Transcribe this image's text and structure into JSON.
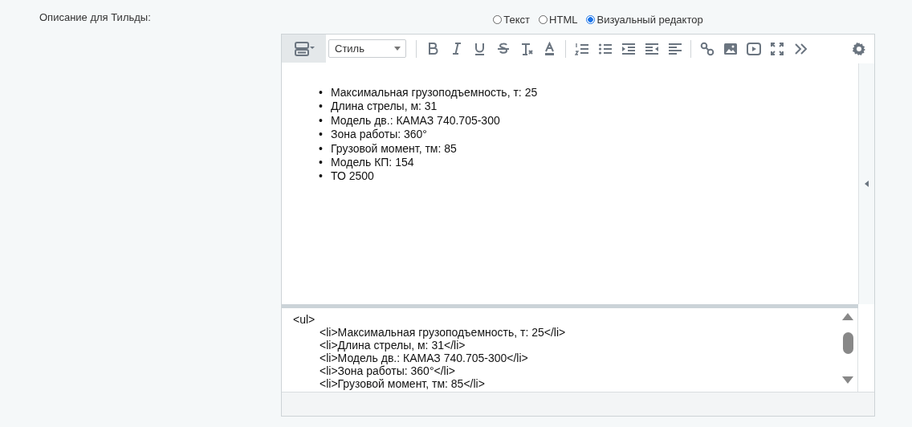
{
  "field_label": "Описание для Тильды:",
  "mode_options": [
    {
      "label": "Текст",
      "selected": false
    },
    {
      "label": "HTML",
      "selected": false
    },
    {
      "label": "Визуальный редактор",
      "selected": true
    }
  ],
  "toolbar": {
    "style_select": "Стиль"
  },
  "content_items": [
    {
      "marker": "•",
      "text": "Максимальная грузоподъемность, т: 25"
    },
    {
      "marker": "•",
      "text": "Длина стрелы, м: 31"
    },
    {
      "marker": "•",
      "text": "Модель дв.: КАМАЗ 740.705-300"
    },
    {
      "marker": "•",
      "text": "Зона работы: 360°"
    },
    {
      "marker": "•",
      "text": "Грузовой момент, тм: 85"
    },
    {
      "marker": "•",
      "text": "Модель КП: 154"
    },
    {
      "marker": "•",
      "text": "ТО 2500"
    }
  ],
  "source_lines": [
    {
      "text": "<ul>",
      "children": [
        {
          "text": "<li>Максимальная грузоподъемность, т: 25</li>"
        },
        {
          "text": "<li>Длина стрелы, м: 31</li>"
        },
        {
          "text": "<li>Модель дв.: КАМАЗ 740.705-300</li>"
        },
        {
          "text": "<li>Зона работы: 360°</li>"
        },
        {
          "text": "<li>Грузовой момент, тм: 85</li>"
        }
      ]
    }
  ]
}
